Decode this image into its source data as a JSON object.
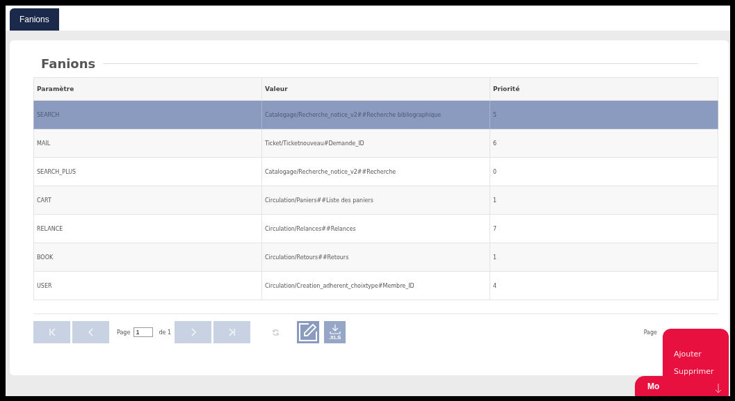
{
  "tabs": [
    {
      "label": "Fanions",
      "selected": true
    }
  ],
  "panel": {
    "title": "Fanions"
  },
  "table": {
    "columns": [
      "Paramètre",
      "Valeur",
      "Priorité"
    ],
    "rows": [
      {
        "cells": [
          "SEARCH",
          "Catalogage/Recherche_notice_v2##Recherche bibliographique",
          "5"
        ],
        "selected": true
      },
      {
        "cells": [
          "MAIL",
          "Ticket/Ticketnouveau#Demande_ID",
          "6"
        ],
        "selected": false
      },
      {
        "cells": [
          "SEARCH_PLUS",
          "Catalogage/Recherche_notice_v2##Recherche",
          "0"
        ],
        "selected": false
      },
      {
        "cells": [
          "CART",
          "Circulation/Paniers##Liste des paniers",
          "1"
        ],
        "selected": false
      },
      {
        "cells": [
          "RELANCE",
          "Circulation/Relances##Relances",
          "7"
        ],
        "selected": false
      },
      {
        "cells": [
          "BOOK",
          "Circulation/Retours##Retours",
          "1"
        ],
        "selected": false
      },
      {
        "cells": [
          "USER",
          "Circulation/Creation_adherent_choixtype#Membre_ID",
          "4"
        ],
        "selected": false
      }
    ]
  },
  "pager": {
    "page_label": "Page",
    "page_value": "1",
    "of_label": "de 1",
    "xls_label": ".XLS",
    "summary": "Page"
  },
  "menu": {
    "items": [
      "Ajouter",
      "Supprimer"
    ],
    "button_label": "Mo"
  }
}
